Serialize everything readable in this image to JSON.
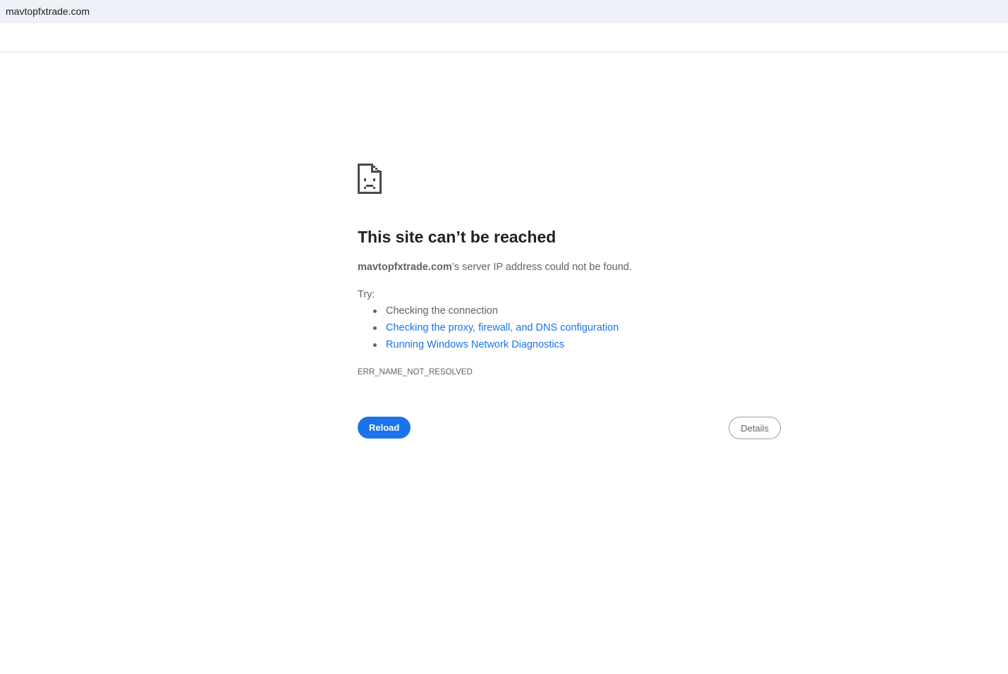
{
  "browser": {
    "address": "mavtopfxtrade.com"
  },
  "error": {
    "icon": "sad-document-icon",
    "title": "This site can’t be reached",
    "host": "mavtopfxtrade.com",
    "message_suffix": "’s server IP address could not be found.",
    "try_label": "Try:",
    "suggestions": [
      {
        "text": "Checking the connection",
        "is_link": false
      },
      {
        "text": "Checking the proxy, firewall, and DNS configuration",
        "is_link": true
      },
      {
        "text": "Running Windows Network Diagnostics",
        "is_link": true
      }
    ],
    "code": "ERR_NAME_NOT_RESOLVED"
  },
  "buttons": {
    "reload_label": "Reload",
    "details_label": "Details"
  },
  "colors": {
    "accent": "#1a73e8",
    "text_secondary": "#5f6368",
    "title": "#202124",
    "address_bar_bg": "#eef1f8"
  }
}
